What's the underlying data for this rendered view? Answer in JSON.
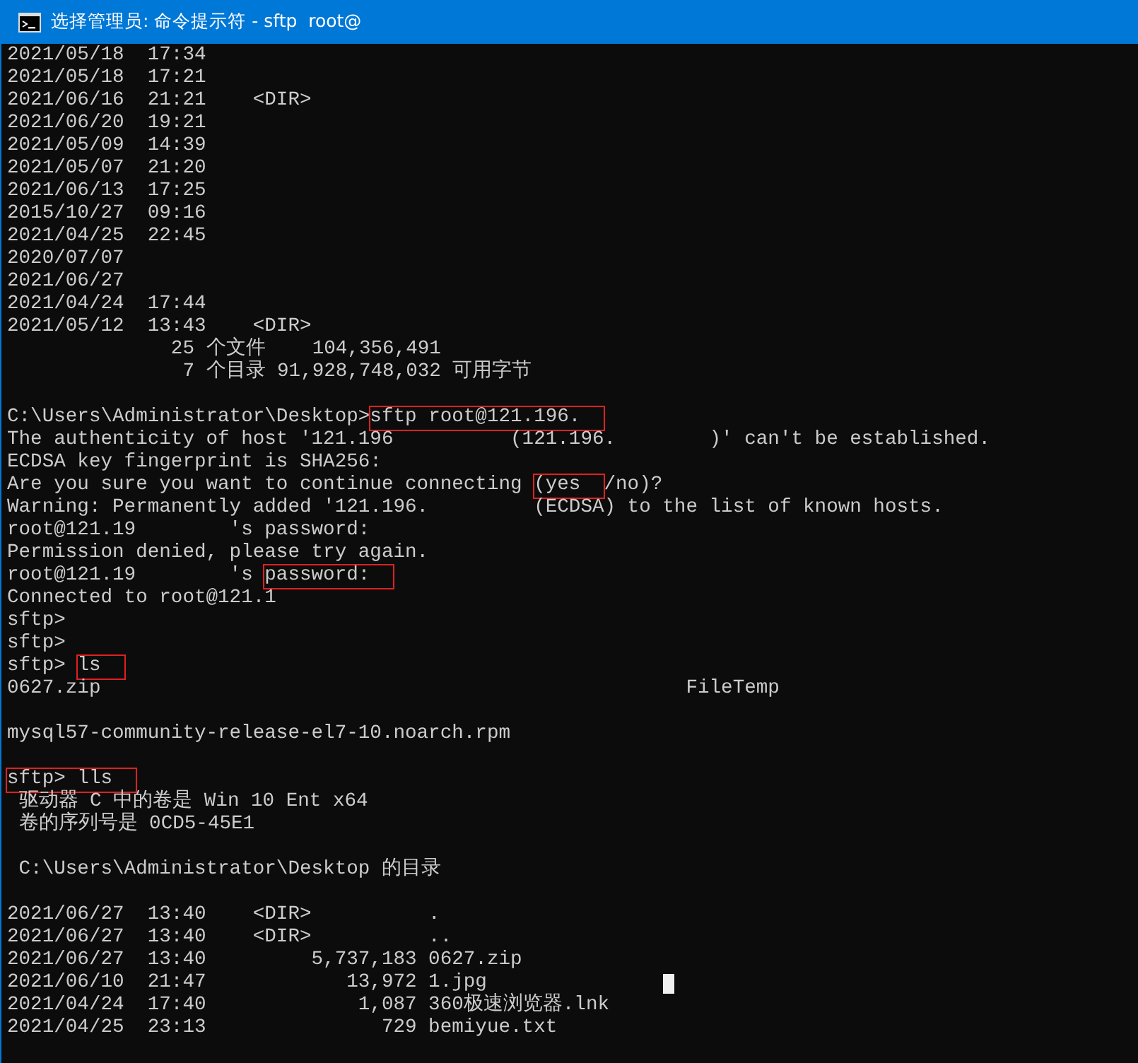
{
  "window": {
    "title": "选择管理员: 命令提示符 - sftp  root@"
  },
  "console": {
    "lines": [
      {
        "text": "2021/05/18  17:34"
      },
      {
        "text": "2021/05/18  17:21"
      },
      {
        "text": "2021/06/16  21:21    <DIR>"
      },
      {
        "text": "2021/06/20  19:21"
      },
      {
        "text": "2021/05/09  14:39"
      },
      {
        "text": "2021/05/07  21:20"
      },
      {
        "text": "2021/06/13  17:25"
      },
      {
        "text": "2015/10/27  09:16"
      },
      {
        "text": "2021/04/25  22:45"
      },
      {
        "text": "2020/07/07"
      },
      {
        "text": "2021/06/27"
      },
      {
        "text": "2021/04/24  17:44"
      },
      {
        "text": "2021/05/12  13:43    <DIR>"
      },
      {
        "text": "              25 个文件    104,356,491"
      },
      {
        "text": "               7 个目录 91,928,748,032 可用字节"
      },
      {
        "text": "C:\\Users\\Administrator\\Desktop>",
        "boxed": "sftp root@121.196.",
        "blank_before": true
      },
      {
        "text": "The authenticity of host '121.196          (121.196.        )' can't be established."
      },
      {
        "text": "ECDSA key fingerprint is SHA256:"
      },
      {
        "text": "Are you sure you want to continue connecting ",
        "boxed": "(yes",
        "after": "/no)?"
      },
      {
        "text": "Warning: Permanently added '121.196.         (ECDSA) to the list of known hosts."
      },
      {
        "text": "root@121.19        's password:"
      },
      {
        "text": "Permission denied, please try again."
      },
      {
        "text": "root@121.19        's ",
        "boxed": "password:"
      },
      {
        "text": "Connected to root@121.1"
      },
      {
        "text": "sftp>"
      },
      {
        "text": "sftp>"
      },
      {
        "text": "sftp> ",
        "boxed": "ls"
      },
      {
        "text": "0627.zip                                                  FileTemp"
      },
      {
        "text": "mysql57-community-release-el7-10.noarch.rpm",
        "blank_before": true
      },
      {
        "boxed": "sftp> lls",
        "blank_before": true
      },
      {
        "text": " 驱动器 C 中的卷是 Win 10 Ent x64"
      },
      {
        "text": " 卷的序列号是 0CD5-45E1"
      },
      {
        "text": " C:\\Users\\Administrator\\Desktop 的目录",
        "blank_before": true
      },
      {
        "text": "2021/06/27  13:40    <DIR>          .",
        "blank_before": true
      },
      {
        "text": "2021/06/27  13:40    <DIR>          .."
      },
      {
        "text": "2021/06/27  13:40         5,737,183 0627.zip"
      },
      {
        "text": "2021/06/10  21:47            13,972 1.jpg",
        "cursor": true
      },
      {
        "text": "2021/04/24  17:40             1,087 360极速浏览器.lnk"
      },
      {
        "text": "2021/04/25  23:13               729 bemiyue.txt"
      }
    ]
  }
}
